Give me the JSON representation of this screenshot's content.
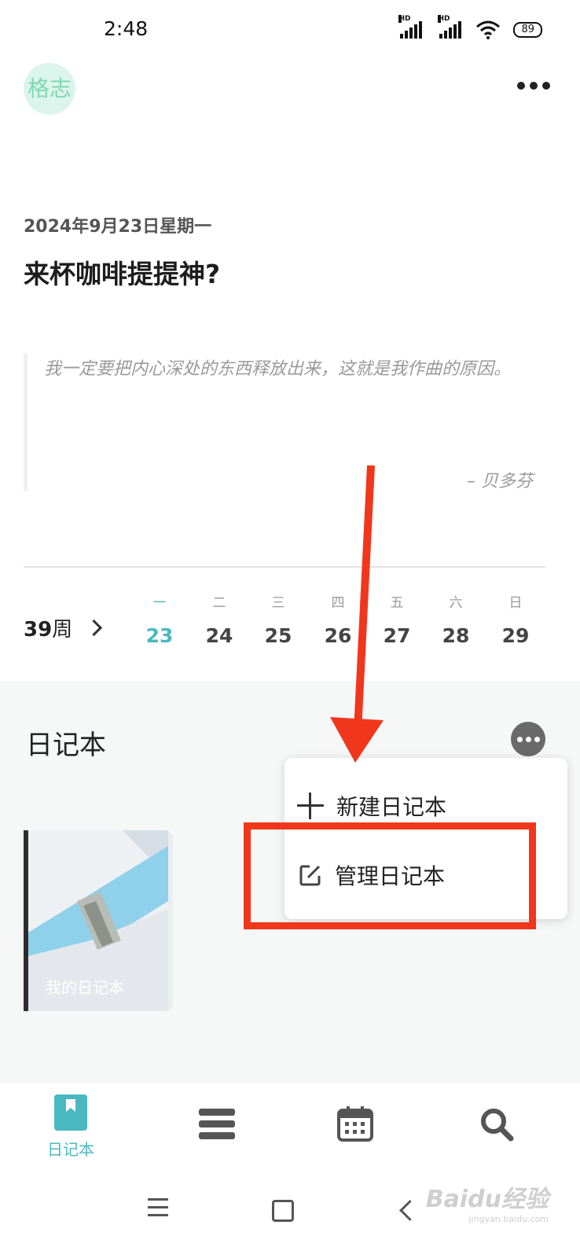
{
  "status_bar": {
    "time": "2:48",
    "signal1_label": "HD",
    "signal2_label": "HD",
    "battery": "89"
  },
  "header": {
    "avatar_text": "格志",
    "more_icon": "more-horizontal-icon"
  },
  "entry": {
    "date": "2024年9月23日星期一",
    "title": "来杯咖啡提提神?"
  },
  "quote": {
    "text": "我一定要把内心深处的东西释放出来，这就是我作曲的原因。",
    "author": "– 贝多芬"
  },
  "week": {
    "number": "39",
    "suffix": "周",
    "days": [
      {
        "weekday": "一",
        "date": "23",
        "active": true
      },
      {
        "weekday": "二",
        "date": "24"
      },
      {
        "weekday": "三",
        "date": "25"
      },
      {
        "weekday": "四",
        "date": "26"
      },
      {
        "weekday": "五",
        "date": "27"
      },
      {
        "weekday": "六",
        "date": "28"
      },
      {
        "weekday": "日",
        "date": "29"
      }
    ]
  },
  "notebooks": {
    "section_title": "日记本",
    "items": [
      {
        "name": "我的日记本"
      }
    ]
  },
  "popup_menu": {
    "items": [
      {
        "label": "新建日记本",
        "icon": "plus-icon"
      },
      {
        "label": "管理日记本",
        "icon": "edit-icon"
      }
    ]
  },
  "bottom_nav": {
    "items": [
      {
        "label": "日记本",
        "icon": "bookmark-icon",
        "active": true
      },
      {
        "label": "",
        "icon": "list-icon"
      },
      {
        "label": "",
        "icon": "calendar-icon"
      },
      {
        "label": "",
        "icon": "search-icon"
      }
    ]
  },
  "watermark": {
    "text": "Baidu经验",
    "subtext": "jingyan.baidu.com"
  },
  "colors": {
    "accent": "#4ab8c1",
    "annotation_red": "#f0371c",
    "avatar_bg": "#dcf5ec"
  }
}
